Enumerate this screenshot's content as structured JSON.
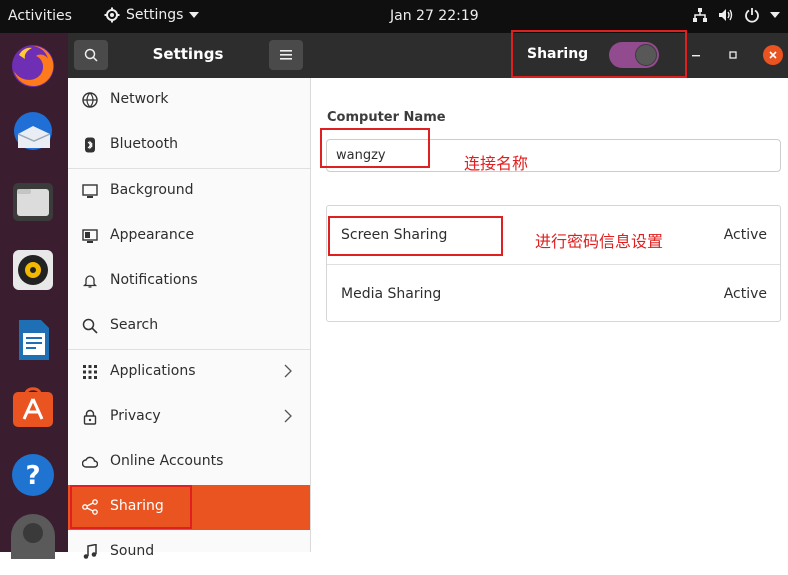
{
  "topbar": {
    "activities": "Activities",
    "app_menu": "Settings",
    "clock": "Jan 27  22:19"
  },
  "dock": {
    "items": [
      "firefox-icon",
      "thunderbird-icon",
      "files-icon",
      "rhythmbox-icon",
      "libreoffice-writer-icon",
      "software-icon",
      "help-icon"
    ]
  },
  "sidebar": {
    "title": "Settings",
    "items": [
      {
        "label": "Network",
        "icon": "network-icon"
      },
      {
        "label": "Bluetooth",
        "icon": "bluetooth-icon"
      },
      {
        "label": "Background",
        "icon": "background-icon"
      },
      {
        "label": "Appearance",
        "icon": "appearance-icon"
      },
      {
        "label": "Notifications",
        "icon": "bell-icon"
      },
      {
        "label": "Search",
        "icon": "search-icon"
      },
      {
        "label": "Applications",
        "icon": "grid-icon"
      },
      {
        "label": "Privacy",
        "icon": "lock-icon"
      },
      {
        "label": "Online Accounts",
        "icon": "cloud-icon"
      },
      {
        "label": "Sharing",
        "icon": "share-icon"
      },
      {
        "label": "Sound",
        "icon": "music-icon"
      }
    ],
    "selected": "Sharing"
  },
  "header": {
    "title": "Sharing",
    "toggle_on": true
  },
  "main": {
    "computer_name_label": "Computer Name",
    "computer_name_value": "wangzy",
    "services": [
      {
        "name": "Screen Sharing",
        "state": "Active"
      },
      {
        "name": "Media Sharing",
        "state": "Active"
      }
    ]
  },
  "annotations": {
    "name_note": "连接名称",
    "screen_note": "进行密码信息设置",
    "color": "#e02020"
  },
  "colors": {
    "accent": "#e95420",
    "toggle": "#914b8e"
  }
}
